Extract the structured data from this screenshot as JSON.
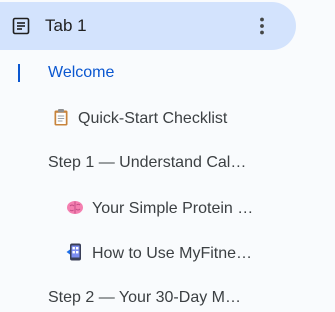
{
  "tab": {
    "title": "Tab 1",
    "doc_icon": "document-icon",
    "menu_icon": "more-vert-icon"
  },
  "outline": {
    "items": [
      {
        "label": "Welcome",
        "icon": null,
        "active": true
      },
      {
        "label": "Quick-Start Checklist",
        "icon": "clipboard-icon"
      },
      {
        "label": "Step 1 — Understand Cal…",
        "icon": null
      },
      {
        "label": "Your Simple Protein …",
        "icon": "brain-icon"
      },
      {
        "label": "How to Use MyFitne…",
        "icon": "phone-icon"
      },
      {
        "label": "Step 2 — Your 30-Day M…",
        "icon": null
      }
    ]
  },
  "colors": {
    "active_tab_bg": "#d3e3fd",
    "active_text": "#0b57d0",
    "text": "#3c4043"
  }
}
